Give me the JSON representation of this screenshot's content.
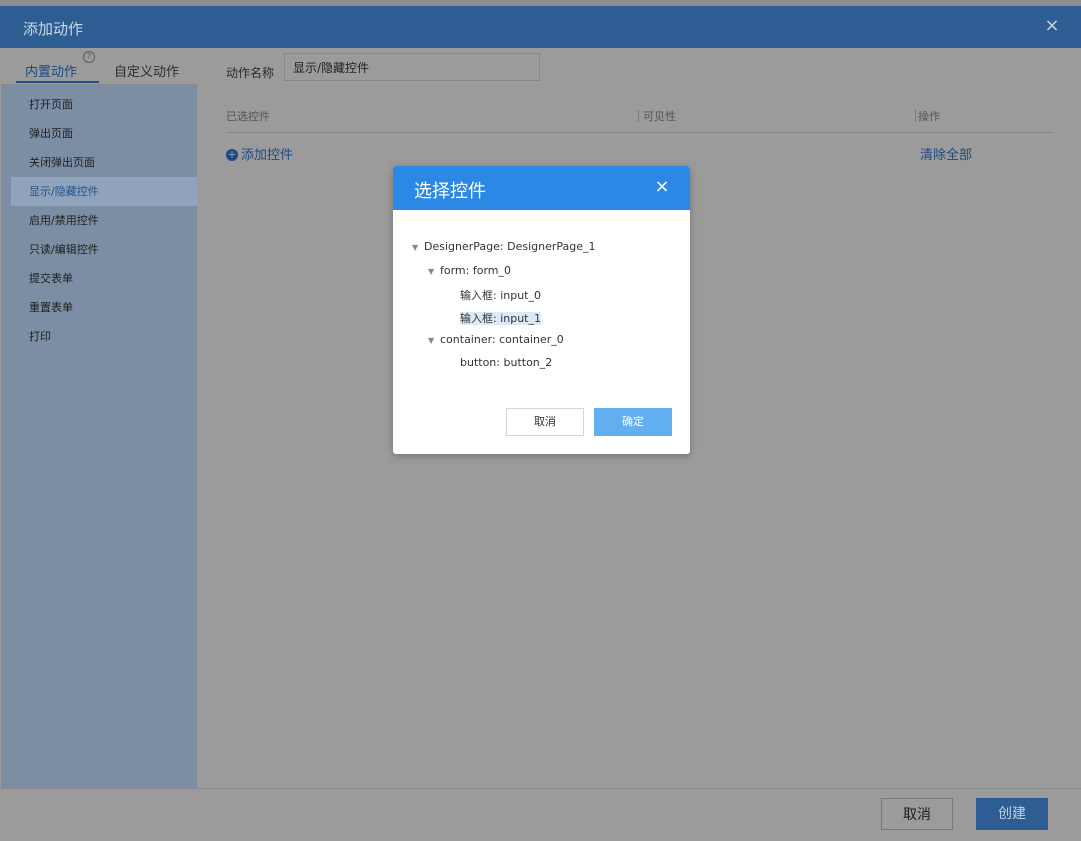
{
  "outer": {
    "title": "添加动作",
    "close_icon": "×"
  },
  "tabs": {
    "builtin": "内置动作",
    "help_icon": "?",
    "custom": "自定义动作"
  },
  "actions": [
    "打开页面",
    "弹出页面",
    "关闭弹出页面",
    "显示/隐藏控件",
    "启用/禁用控件",
    "只读/编辑控件",
    "提交表单",
    "重置表单",
    "打印"
  ],
  "main": {
    "name_label": "动作名称",
    "name_value": "显示/隐藏控件",
    "col_selected": "已选控件",
    "col_visibility": "可见性",
    "col_operation": "操作",
    "add_icon": "+",
    "add_control": "添加控件",
    "clear_all": "清除全部"
  },
  "footer": {
    "cancel": "取消",
    "create": "创建"
  },
  "dialog": {
    "title": "选择控件",
    "close_icon": "×",
    "tree": [
      {
        "label": "DesignerPage: DesignerPage_1"
      },
      {
        "label": "form: form_0"
      },
      {
        "label": "输入框: input_0"
      },
      {
        "label": "输入框: input_1"
      },
      {
        "label": "container: container_0"
      },
      {
        "label": "button: button_2"
      }
    ],
    "cancel": "取消",
    "ok": "确定"
  }
}
